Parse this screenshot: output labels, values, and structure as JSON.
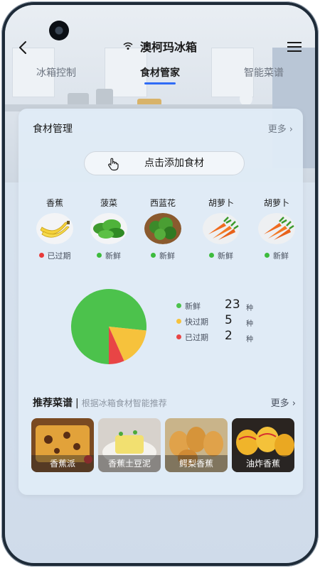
{
  "app": {
    "title": "澳柯玛冰箱"
  },
  "tabs": [
    {
      "label": "冰箱控制",
      "active": false
    },
    {
      "label": "食材管家",
      "active": true
    },
    {
      "label": "智能菜谱",
      "active": false
    }
  ],
  "food_section": {
    "title": "食材管理",
    "more_label": "更多",
    "add_button_label": "点击添加食材",
    "items": [
      {
        "name": "香蕉",
        "status": "已过期",
        "status_color": "#e83a3a",
        "icon": "banana"
      },
      {
        "name": "菠菜",
        "status": "新鲜",
        "status_color": "#3dbb3d",
        "icon": "spinach"
      },
      {
        "name": "西蓝花",
        "status": "新鲜",
        "status_color": "#3dbb3d",
        "icon": "broccoli"
      },
      {
        "name": "胡萝卜",
        "status": "新鲜",
        "status_color": "#3dbb3d",
        "icon": "carrot"
      },
      {
        "name": "胡萝卜",
        "status": "新鲜",
        "status_color": "#3dbb3d",
        "icon": "carrot"
      }
    ]
  },
  "stats": {
    "unit": "种",
    "rows": [
      {
        "label": "新鲜",
        "count": "23",
        "color": "#4cc24c"
      },
      {
        "label": "快过期",
        "count": "5",
        "color": "#f6c23c"
      },
      {
        "label": "已过期",
        "count": "2",
        "color": "#e84545"
      }
    ]
  },
  "chart_data": {
    "type": "pie",
    "categories": [
      "新鲜",
      "快过期",
      "已过期"
    ],
    "values": [
      23,
      5,
      2
    ],
    "colors": [
      "#4cc24c",
      "#f6c23c",
      "#e84545"
    ],
    "title": ""
  },
  "recipes": {
    "title": "推荐菜谱",
    "separator": "|",
    "subtitle": "根据冰箱食材智能推荐",
    "more_label": "更多",
    "items": [
      {
        "label": "香蕉派"
      },
      {
        "label": "香蕉土豆泥"
      },
      {
        "label": "鳄梨香蕉"
      },
      {
        "label": "油炸香蕉"
      }
    ]
  }
}
